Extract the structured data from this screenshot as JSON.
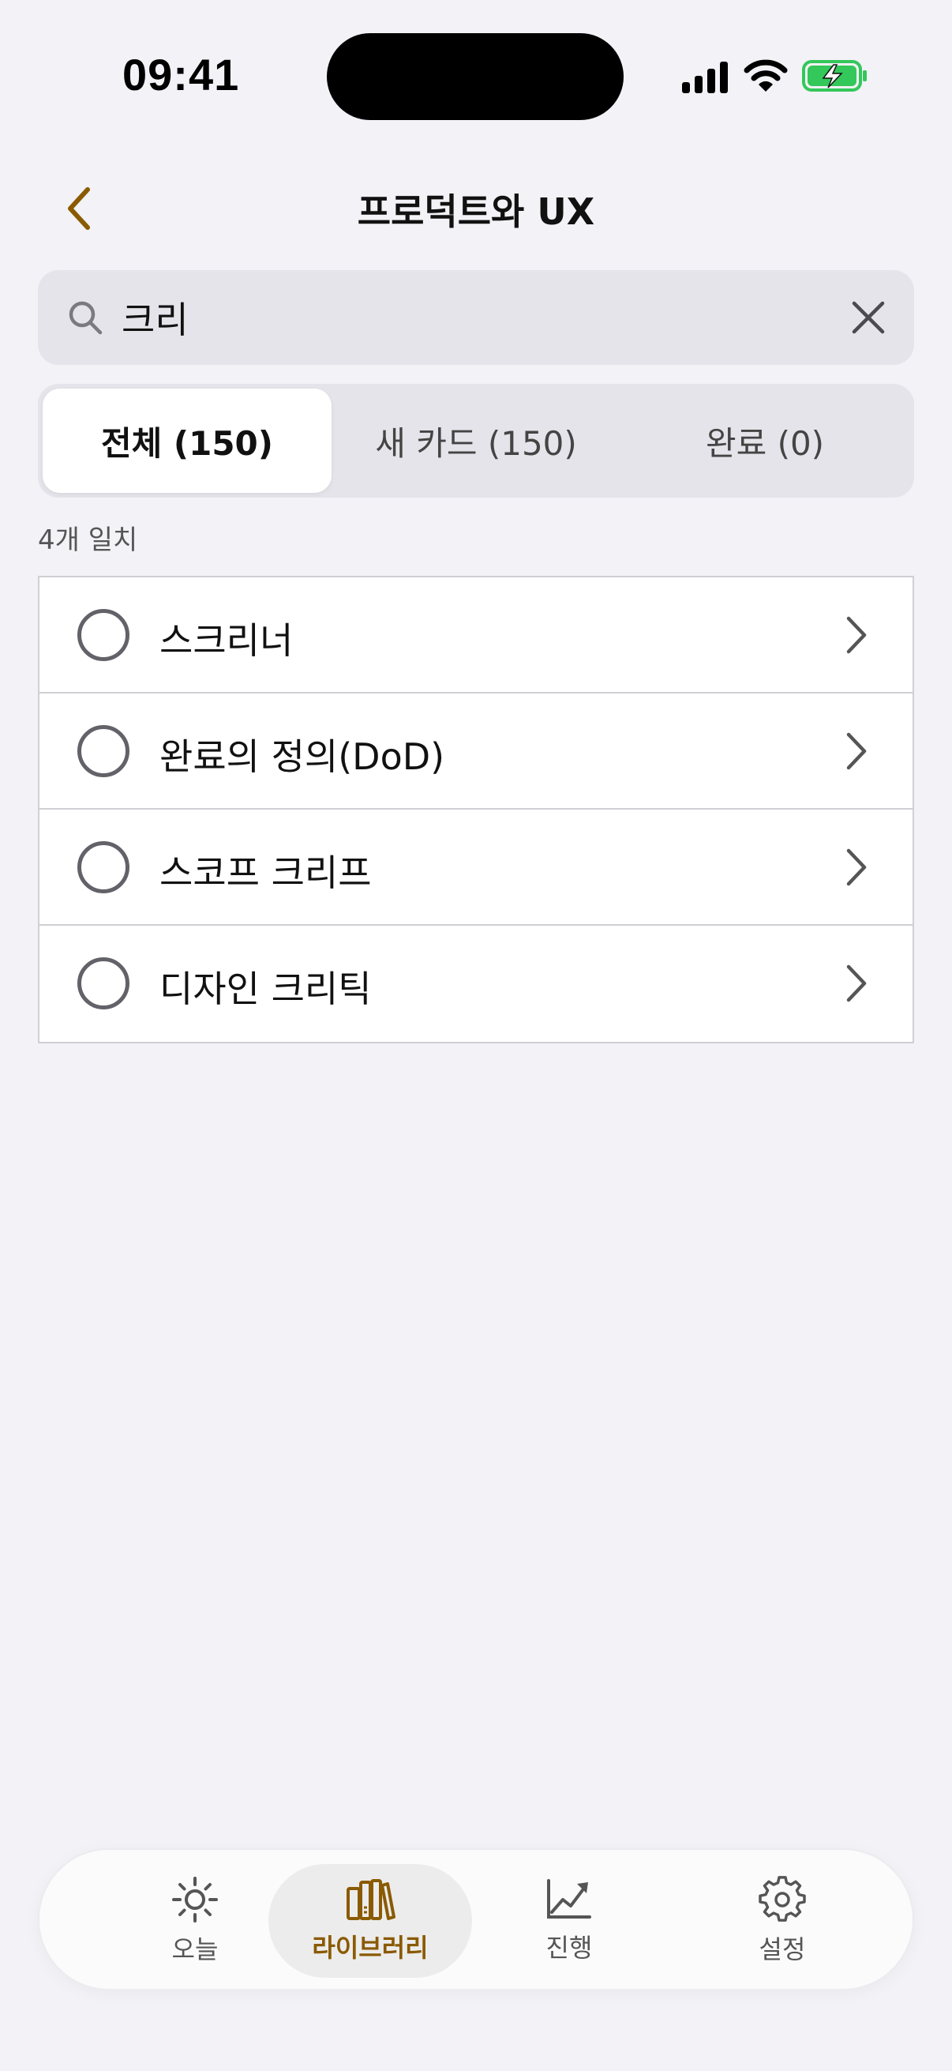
{
  "status_bar": {
    "time": "09:41"
  },
  "nav": {
    "title": "프로덕트와 UX"
  },
  "search": {
    "value": "크리",
    "placeholder": ""
  },
  "segments": [
    {
      "label": "전체 (150)",
      "active": true
    },
    {
      "label": "새 카드 (150)",
      "active": false
    },
    {
      "label": "완료 (0)",
      "active": false
    }
  ],
  "match_count": "4개 일치",
  "results": [
    {
      "label": "스크리너"
    },
    {
      "label": "완료의 정의(DoD)"
    },
    {
      "label": "스코프 크리프"
    },
    {
      "label": "디자인 크리틱"
    }
  ],
  "tabs": [
    {
      "label": "오늘",
      "icon": "sun-icon"
    },
    {
      "label": "라이브러리",
      "icon": "books-icon"
    },
    {
      "label": "진행",
      "icon": "chart-icon"
    },
    {
      "label": "설정",
      "icon": "gear-icon"
    }
  ],
  "colors": {
    "accent": "#8a5a00",
    "background": "#f2f2f7",
    "battery": "#34c759"
  }
}
